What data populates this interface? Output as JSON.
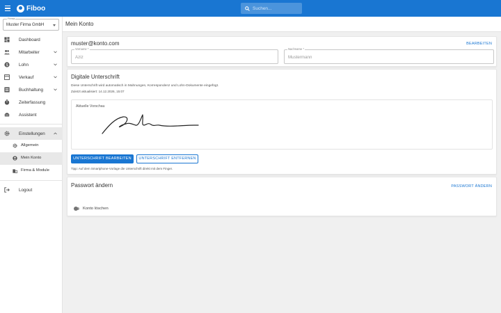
{
  "app": {
    "name": "Fiboo",
    "brand_color": "#1976d2"
  },
  "search": {
    "placeholder": "Suchen..."
  },
  "sidebar": {
    "firma_label": "Firma",
    "firma_value": "Muster Firma GmbH",
    "items": [
      {
        "label": "Dashboard",
        "icon": "dashboard-icon"
      },
      {
        "label": "Mitarbeiter",
        "icon": "people-icon",
        "expandable": true
      },
      {
        "label": "Lohn",
        "icon": "money-icon",
        "expandable": true
      },
      {
        "label": "Verkauf",
        "icon": "sales-icon",
        "expandable": true
      },
      {
        "label": "Buchhaltung",
        "icon": "accounting-icon",
        "expandable": true
      },
      {
        "label": "Zeiterfassung",
        "icon": "timer-icon"
      },
      {
        "label": "Assistent",
        "icon": "assistant-icon"
      }
    ],
    "settings": {
      "label": "Einstellungen",
      "icon": "gear-icon",
      "expanded": true,
      "sub_items": [
        {
          "label": "Allgemein",
          "icon": "gear-small-icon"
        },
        {
          "label": "Mein Konto",
          "icon": "account-icon",
          "active": true
        },
        {
          "label": "Firma & Module",
          "icon": "building-icon"
        }
      ]
    },
    "logout": {
      "label": "Logout",
      "icon": "logout-icon"
    }
  },
  "page": {
    "title": "Mein Konto"
  },
  "account": {
    "email": "muster@konto.com",
    "edit_label": "BEARBEITEN",
    "first_name_label": "Vorname *",
    "first_name_value": "Aziz",
    "last_name_label": "Nachname *",
    "last_name_value": "Mustermann"
  },
  "signature": {
    "title": "Digitale Unterschrift",
    "description": "Diese Unterschrift wird automatisch in Mahnungen, Korrespondenz und Lohn-Dokumente eingefügt.",
    "updated": "Zuletzt aktualisiert: 14.12.2026, 15:07",
    "preview_label": "Aktuelle Vorschau",
    "edit_button": "UNTERSCHRIFT BEARBEITEN",
    "remove_button": "UNTERSCHRIFT ENTFERNEN",
    "tip": "Tipp: Auf dem Smartphone-Vorlage die Unterschrift direkt mit dem Finger."
  },
  "password": {
    "title": "Passwort ändern",
    "change_label": "PASSWORT ÄNDERN",
    "delete_label": "Konto löschen"
  }
}
